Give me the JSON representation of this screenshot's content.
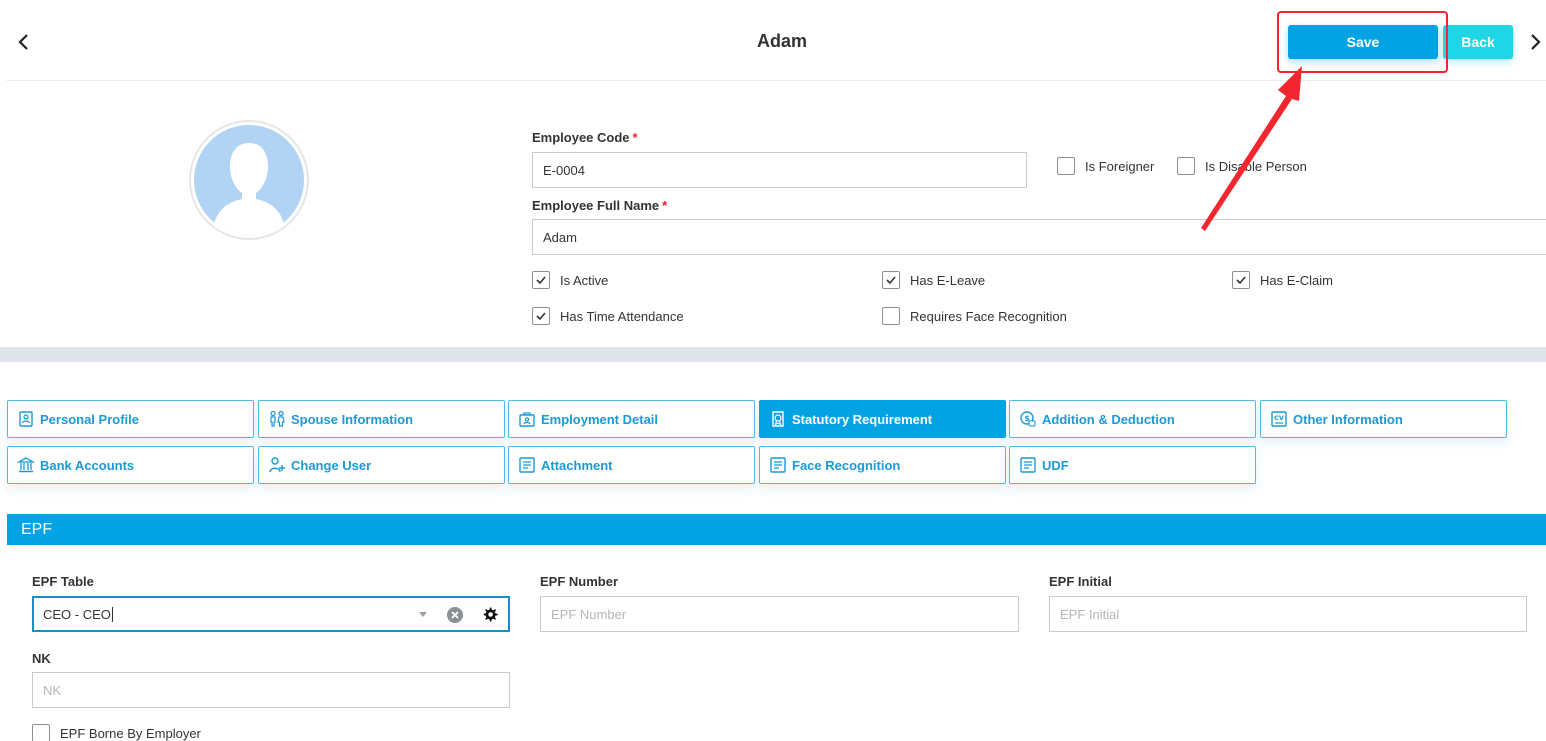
{
  "header": {
    "title": "Adam",
    "save_label": "Save",
    "back_label": "Back",
    "prev_icon": "chevron-left-icon",
    "next_icon": "chevron-right-icon"
  },
  "profile": {
    "employee_code_label": "Employee Code",
    "employee_code_value": "E-0004",
    "full_name_label": "Employee Full Name",
    "full_name_value": "Adam",
    "required_mark": "*",
    "is_foreigner": {
      "label": "Is Foreigner",
      "checked": false
    },
    "is_disable_person": {
      "label": "Is Disable Person",
      "checked": false
    },
    "is_active": {
      "label": "Is Active",
      "checked": true
    },
    "has_e_leave": {
      "label": "Has E-Leave",
      "checked": true
    },
    "has_e_claim": {
      "label": "Has E-Claim",
      "checked": true
    },
    "has_time_attendance": {
      "label": "Has Time Attendance",
      "checked": true
    },
    "requires_face_recognition": {
      "label": "Requires Face Recognition",
      "checked": false
    }
  },
  "tabs": [
    {
      "label": "Personal Profile",
      "icon": "personal-profile-icon",
      "active": false
    },
    {
      "label": "Spouse Information",
      "icon": "spouse-icon",
      "active": false
    },
    {
      "label": "Employment Detail",
      "icon": "employment-detail-icon",
      "active": false
    },
    {
      "label": "Statutory Requirement",
      "icon": "statutory-icon",
      "active": true
    },
    {
      "label": "Addition & Deduction",
      "icon": "addition-deduction-icon",
      "active": false
    },
    {
      "label": "Other Information",
      "icon": "cv-icon",
      "active": false
    },
    {
      "label": "Bank Accounts",
      "icon": "bank-icon",
      "active": false
    },
    {
      "label": "Change User",
      "icon": "change-user-icon",
      "active": false
    },
    {
      "label": "Attachment",
      "icon": "attachment-icon",
      "active": false
    },
    {
      "label": "Face Recognition",
      "icon": "face-recognition-icon",
      "active": false
    },
    {
      "label": "UDF",
      "icon": "udf-icon",
      "active": false
    }
  ],
  "epf": {
    "section_title": "EPF",
    "table_label": "EPF Table",
    "table_value": "CEO - CEO",
    "number_label": "EPF Number",
    "number_placeholder": "EPF Number",
    "initial_label": "EPF Initial",
    "initial_placeholder": "EPF Initial",
    "nk_label": "NK",
    "nk_placeholder": "NK",
    "borne_by_employer": {
      "label": "EPF Borne By Employer",
      "checked": false
    }
  },
  "colors": {
    "primary": "#02a2e3",
    "back_button": "#1fd6e6",
    "annotation": "#f2262f",
    "required": "#e5242f"
  }
}
